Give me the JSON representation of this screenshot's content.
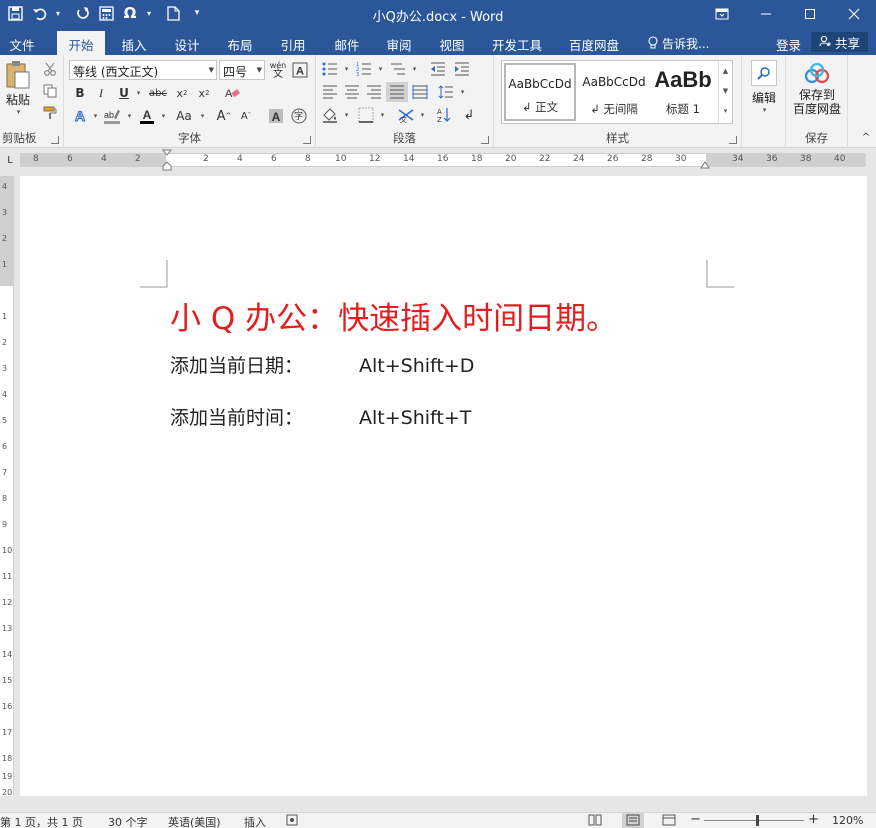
{
  "window": {
    "title": "小Q办公.docx - Word"
  },
  "tabs": [
    "文件",
    "开始",
    "插入",
    "设计",
    "布局",
    "引用",
    "邮件",
    "审阅",
    "视图",
    "开发工具",
    "百度网盘"
  ],
  "active_tab": "开始",
  "tellme": "告诉我...",
  "login": "登录",
  "share": "共享",
  "ribbon": {
    "clipboard": {
      "paste": "粘贴",
      "label": "剪贴板"
    },
    "font": {
      "name": "等线 (西文正文)",
      "size": "四号",
      "label": "字体",
      "phonetic": "wén",
      "enclose": "字"
    },
    "paragraph": {
      "label": "段落"
    },
    "styles": {
      "label": "样式",
      "items": [
        {
          "sample": "AaBbCcDd",
          "name": "↲ 正文"
        },
        {
          "sample": "AaBbCcDd",
          "name": "↲ 无间隔"
        },
        {
          "sample": "AaBb",
          "name": "标题 1"
        }
      ]
    },
    "editing": {
      "edit": "编辑"
    },
    "save": {
      "line1": "保存到",
      "line2": "百度网盘",
      "label": "保存"
    }
  },
  "ruler": {
    "h_numbers": [
      "8",
      "6",
      "4",
      "2",
      "2",
      "4",
      "6",
      "8",
      "10",
      "12",
      "14",
      "16",
      "18",
      "20",
      "22",
      "24",
      "26",
      "28",
      "30",
      "34",
      "36",
      "38",
      "40"
    ],
    "v_numbers": [
      "4",
      "3",
      "2",
      "1",
      "1",
      "2",
      "3",
      "4",
      "5",
      "6",
      "7",
      "8",
      "9",
      "10",
      "11",
      "12",
      "13",
      "14",
      "15",
      "16",
      "17",
      "18",
      "19",
      "20"
    ]
  },
  "document": {
    "title": "小 Q 办公：快速插入时间日期。",
    "lines": [
      {
        "label": "添加当前日期：",
        "shortcut": "Alt+Shift+D"
      },
      {
        "label": "添加当前时间：",
        "shortcut": "Alt+Shift+T"
      }
    ],
    "title_color": "#e31e1e"
  },
  "status": {
    "pages": "第 1 页，共 1 页",
    "words": "30 个字",
    "language": "英语(美国)",
    "mode": "插入",
    "zoom": "120%"
  },
  "colors": {
    "brand": "#2b579a",
    "ribbon_bg": "#f3f3f3"
  }
}
